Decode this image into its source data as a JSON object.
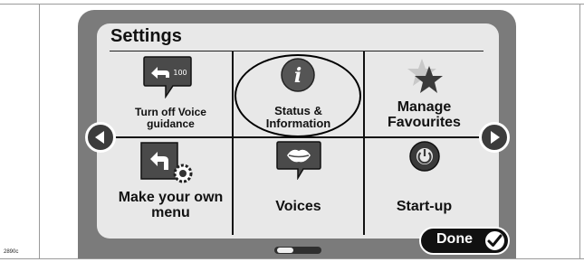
{
  "page": {
    "figure_code": "2890c"
  },
  "header": {
    "title": "Settings"
  },
  "menu": {
    "items": [
      {
        "label": "Turn off Voice guidance",
        "line1": "Turn off Voice",
        "line2": "guidance",
        "icon": "voice-guidance-icon",
        "icon_text": "100"
      },
      {
        "label": "Status & Information",
        "line1": "Status &",
        "line2": "Information",
        "icon": "info-icon",
        "icon_text": "i",
        "highlighted": true
      },
      {
        "label": "Manage Favourites",
        "line1": "Manage",
        "line2": "Favourites",
        "icon": "favourites-star-icon"
      },
      {
        "label": "Make your own menu",
        "line1": "Make your own",
        "line2": "menu",
        "icon": "custom-menu-gear-icon"
      },
      {
        "label": "Voices",
        "line1": "Voices",
        "icon": "lips-speech-icon"
      },
      {
        "label": "Start-up",
        "line1": "Start-up",
        "icon": "power-icon"
      }
    ]
  },
  "nav": {
    "prev_icon": "arrow-left-icon",
    "next_icon": "arrow-right-icon"
  },
  "pager": {
    "pages": 2,
    "current_page": 1
  },
  "footer": {
    "done_label": "Done",
    "done_icon": "checkmark-icon"
  },
  "colors": {
    "device_bezel": "#7b7b7b",
    "screen_bg": "#e8e8e8",
    "button_dark": "#3c3c3c",
    "done_bg": "#111111"
  }
}
